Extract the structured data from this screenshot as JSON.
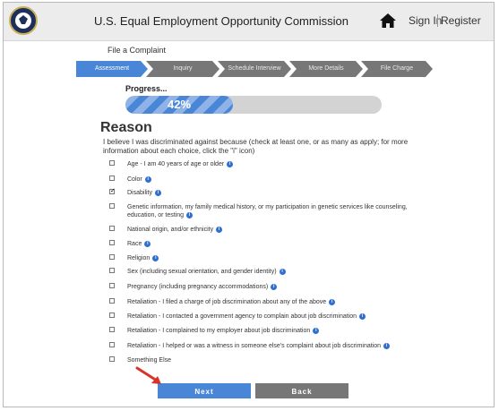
{
  "header": {
    "agency_name": "U.S. Equal Employment Opportunity Commission",
    "signin_label": "Sign In",
    "register_label": "Register"
  },
  "breadcrumb": "File a Complaint",
  "steps": [
    {
      "label": "Assessment",
      "active": true
    },
    {
      "label": "Inquiry",
      "active": false
    },
    {
      "label": "Schedule Interview",
      "active": false
    },
    {
      "label": "More Details",
      "active": false
    },
    {
      "label": "File Charge",
      "active": false
    }
  ],
  "progress": {
    "label": "Progress...",
    "value_text": "42%",
    "value": 42,
    "color": "#4a86d8"
  },
  "reason": {
    "title": "Reason",
    "instructions": "I believe I was discriminated against because (check at least one, or as many as apply; for more information about each choice, click the \"i\" icon)",
    "options": [
      {
        "label": "Age - I am 40 years of age or older",
        "checked": false,
        "info": true
      },
      {
        "label": "Color",
        "checked": false,
        "info": true
      },
      {
        "label": "Disability",
        "checked": true,
        "info": true
      },
      {
        "label": "Genetic information, my family medical history, or my participation in genetic services like counseling, education, or testing",
        "checked": false,
        "info": true
      },
      {
        "label": "National origin, and/or ethnicity",
        "checked": false,
        "info": true
      },
      {
        "label": "Race",
        "checked": false,
        "info": true
      },
      {
        "label": "Religion",
        "checked": false,
        "info": true
      },
      {
        "label": "Sex (including sexual orientation, and gender identity)",
        "checked": false,
        "info": true
      },
      {
        "label": "Pregnancy (including pregnancy accommodations)",
        "checked": false,
        "info": true
      },
      {
        "label": "Retaliation - I filed a charge of job discrimination about any of the above",
        "checked": false,
        "info": true
      },
      {
        "label": "Retaliation - I contacted a government agency to complain about job discrimination",
        "checked": false,
        "info": true
      },
      {
        "label": "Retaliation - I complained to my employer about job discrimination",
        "checked": false,
        "info": true
      },
      {
        "label": "Retaliation - I helped or was a witness in someone else's complaint about job discrimination",
        "checked": false,
        "info": true
      },
      {
        "label": "Something Else",
        "checked": false,
        "info": false
      }
    ]
  },
  "buttons": {
    "next_label": "Next",
    "back_label": "Back"
  }
}
